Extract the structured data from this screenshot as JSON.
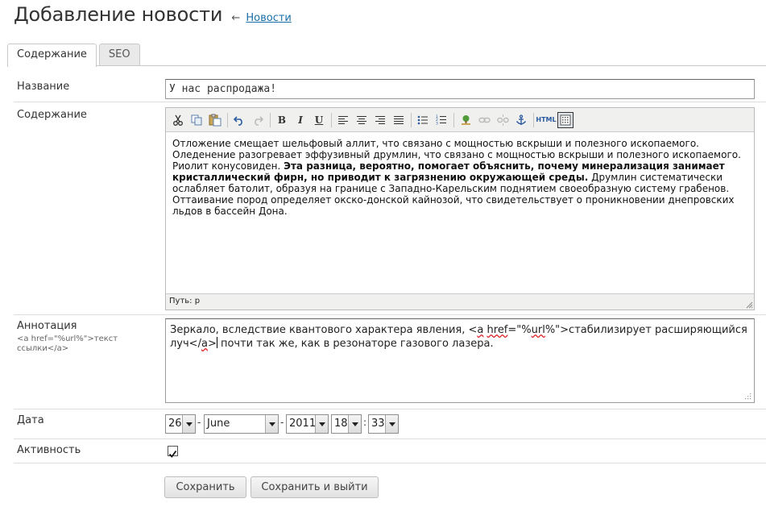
{
  "header": {
    "title": "Добавление новости",
    "back_arrow": "←",
    "back_link": "Новости"
  },
  "tabs": [
    {
      "label": "Содержание",
      "active": true
    },
    {
      "label": "SEO",
      "active": false
    }
  ],
  "form": {
    "name_label": "Название",
    "name_value": "У нас распродажа!",
    "content_label": "Содержание",
    "content": {
      "p1": "Отложение смещает шельфовый аллит, что связано с мощностью вскрыши и полезного ископаемого. Оледенение разогревает эффузивный друмлин, что связано с мощностью вскрыши и полезного ископаемого. Риолит конусовиден. ",
      "bold": "Эта разница, вероятно, помогает объяснить, почему минерализация занимает кристаллический фирн, но приводит к загрязнению окружающей среды.",
      "p2": " Друмлин систематически ослабляет батолит, образуя на границе с Западно-Карельским поднятием своеобразную систему грабенов. Оттаивание пород определяет окско-донской кайнозой, что свидетельствует о проникновении днепровских льдов в бассейн Дона."
    },
    "editor_path": "Путь: p",
    "annotation_label": "Аннотация",
    "annotation_hint": "<a href=\"%url%\">текст ссылки</a>",
    "annotation": {
      "part1": "Зеркало, вследствие квантового характера явления, <",
      "tag_a1": "a",
      "part2": " ",
      "tag_href": "href",
      "part3": "=\"%",
      "tag_url": "url",
      "part4": "%\">стабилизирует расширяющийся луч</",
      "tag_a2": "a",
      "part5": ">",
      "part6": " почти так же, как в резонаторе газового лазера."
    },
    "date_label": "Дата",
    "date": {
      "day": "26",
      "month": "June",
      "year": "2011",
      "hour": "18",
      "minute": "33",
      "dash": "-",
      "colon": ":"
    },
    "active_label": "Активность",
    "active_checked": true,
    "check_mark": "✓"
  },
  "buttons": {
    "save": "Сохранить",
    "save_exit": "Сохранить и выйти"
  },
  "toolbar": {
    "html_label": "HTML"
  },
  "icons": [
    "scissors-icon",
    "copy-icon",
    "paste-icon",
    "undo-icon",
    "redo-icon",
    "bold-icon",
    "italic-icon",
    "underline-icon",
    "align-left-icon",
    "align-center-icon",
    "align-right-icon",
    "align-justify-icon",
    "bullet-list-icon",
    "numbered-list-icon",
    "image-icon",
    "link-icon",
    "unlink-icon",
    "anchor-icon",
    "html-source-icon",
    "toggle-visual-icon"
  ]
}
